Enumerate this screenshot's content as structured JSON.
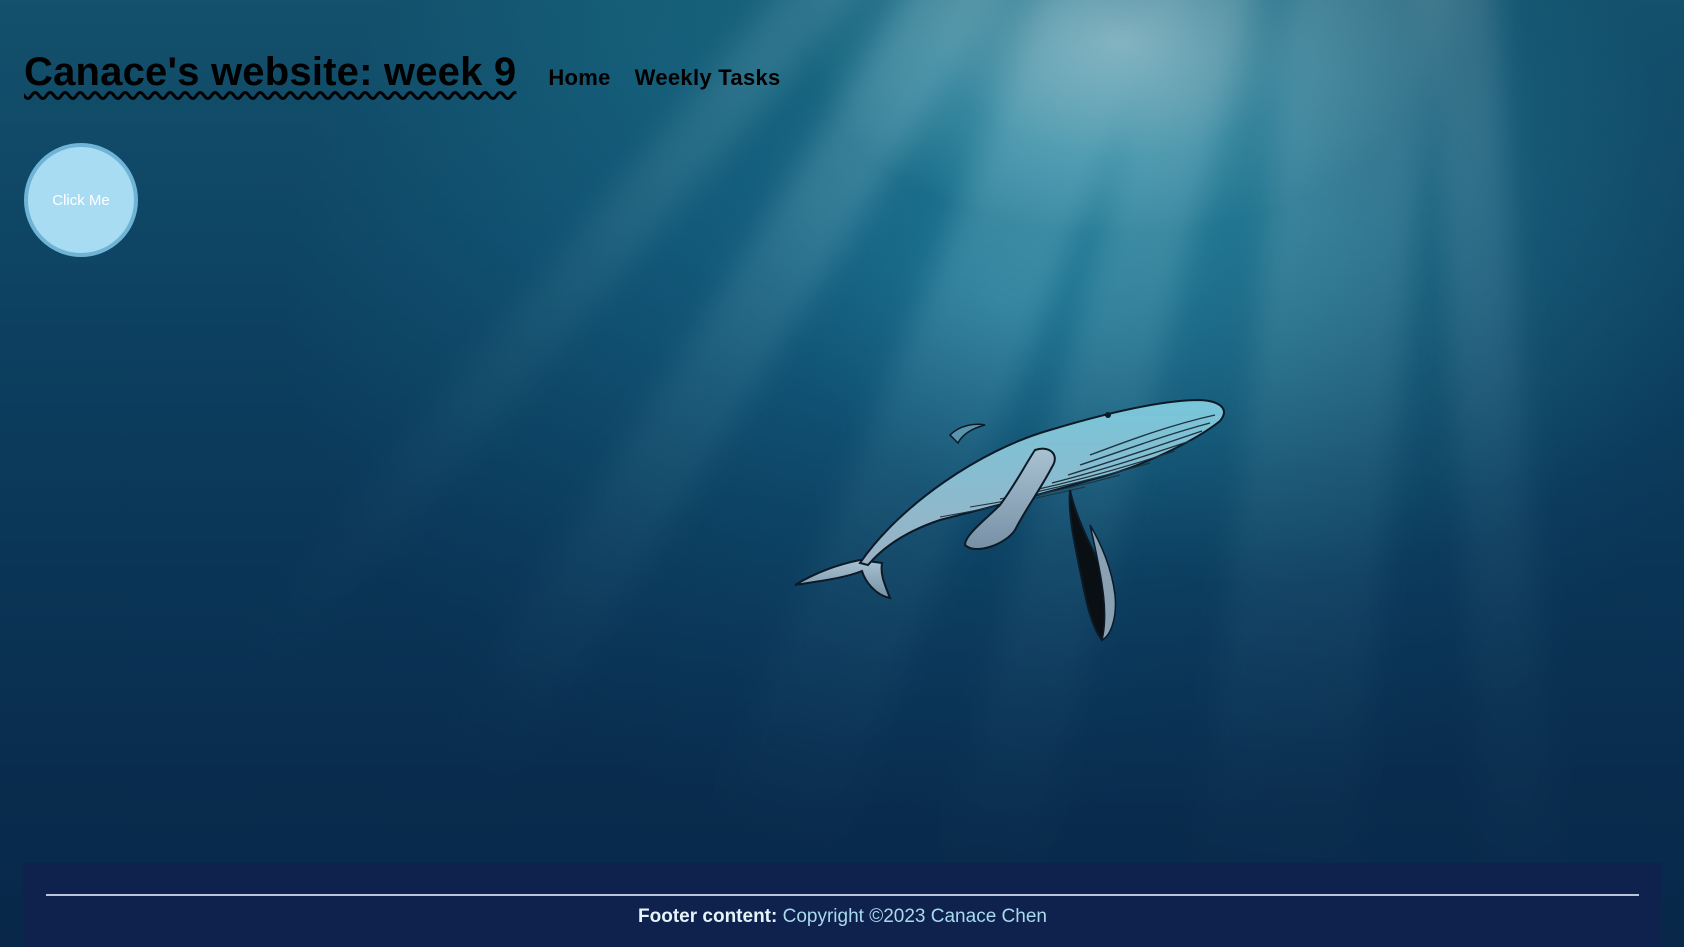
{
  "header": {
    "title": "Canace's website: week 9",
    "nav": [
      {
        "label": "Home"
      },
      {
        "label": "Weekly Tasks"
      }
    ]
  },
  "main": {
    "click_button_label": "Click Me",
    "illustration": "humpback-whale-icon"
  },
  "footer": {
    "label": "Footer content:",
    "text": "Copyright ©2023 Canace Chen"
  },
  "colors": {
    "ocean_deep": "#0b3358",
    "ocean_light": "#1e7f97",
    "button_fill": "#a7dcf2",
    "button_border": "#6fb4d6",
    "footer_bg": "#0e224d",
    "footer_text": "#a9d9ee"
  }
}
